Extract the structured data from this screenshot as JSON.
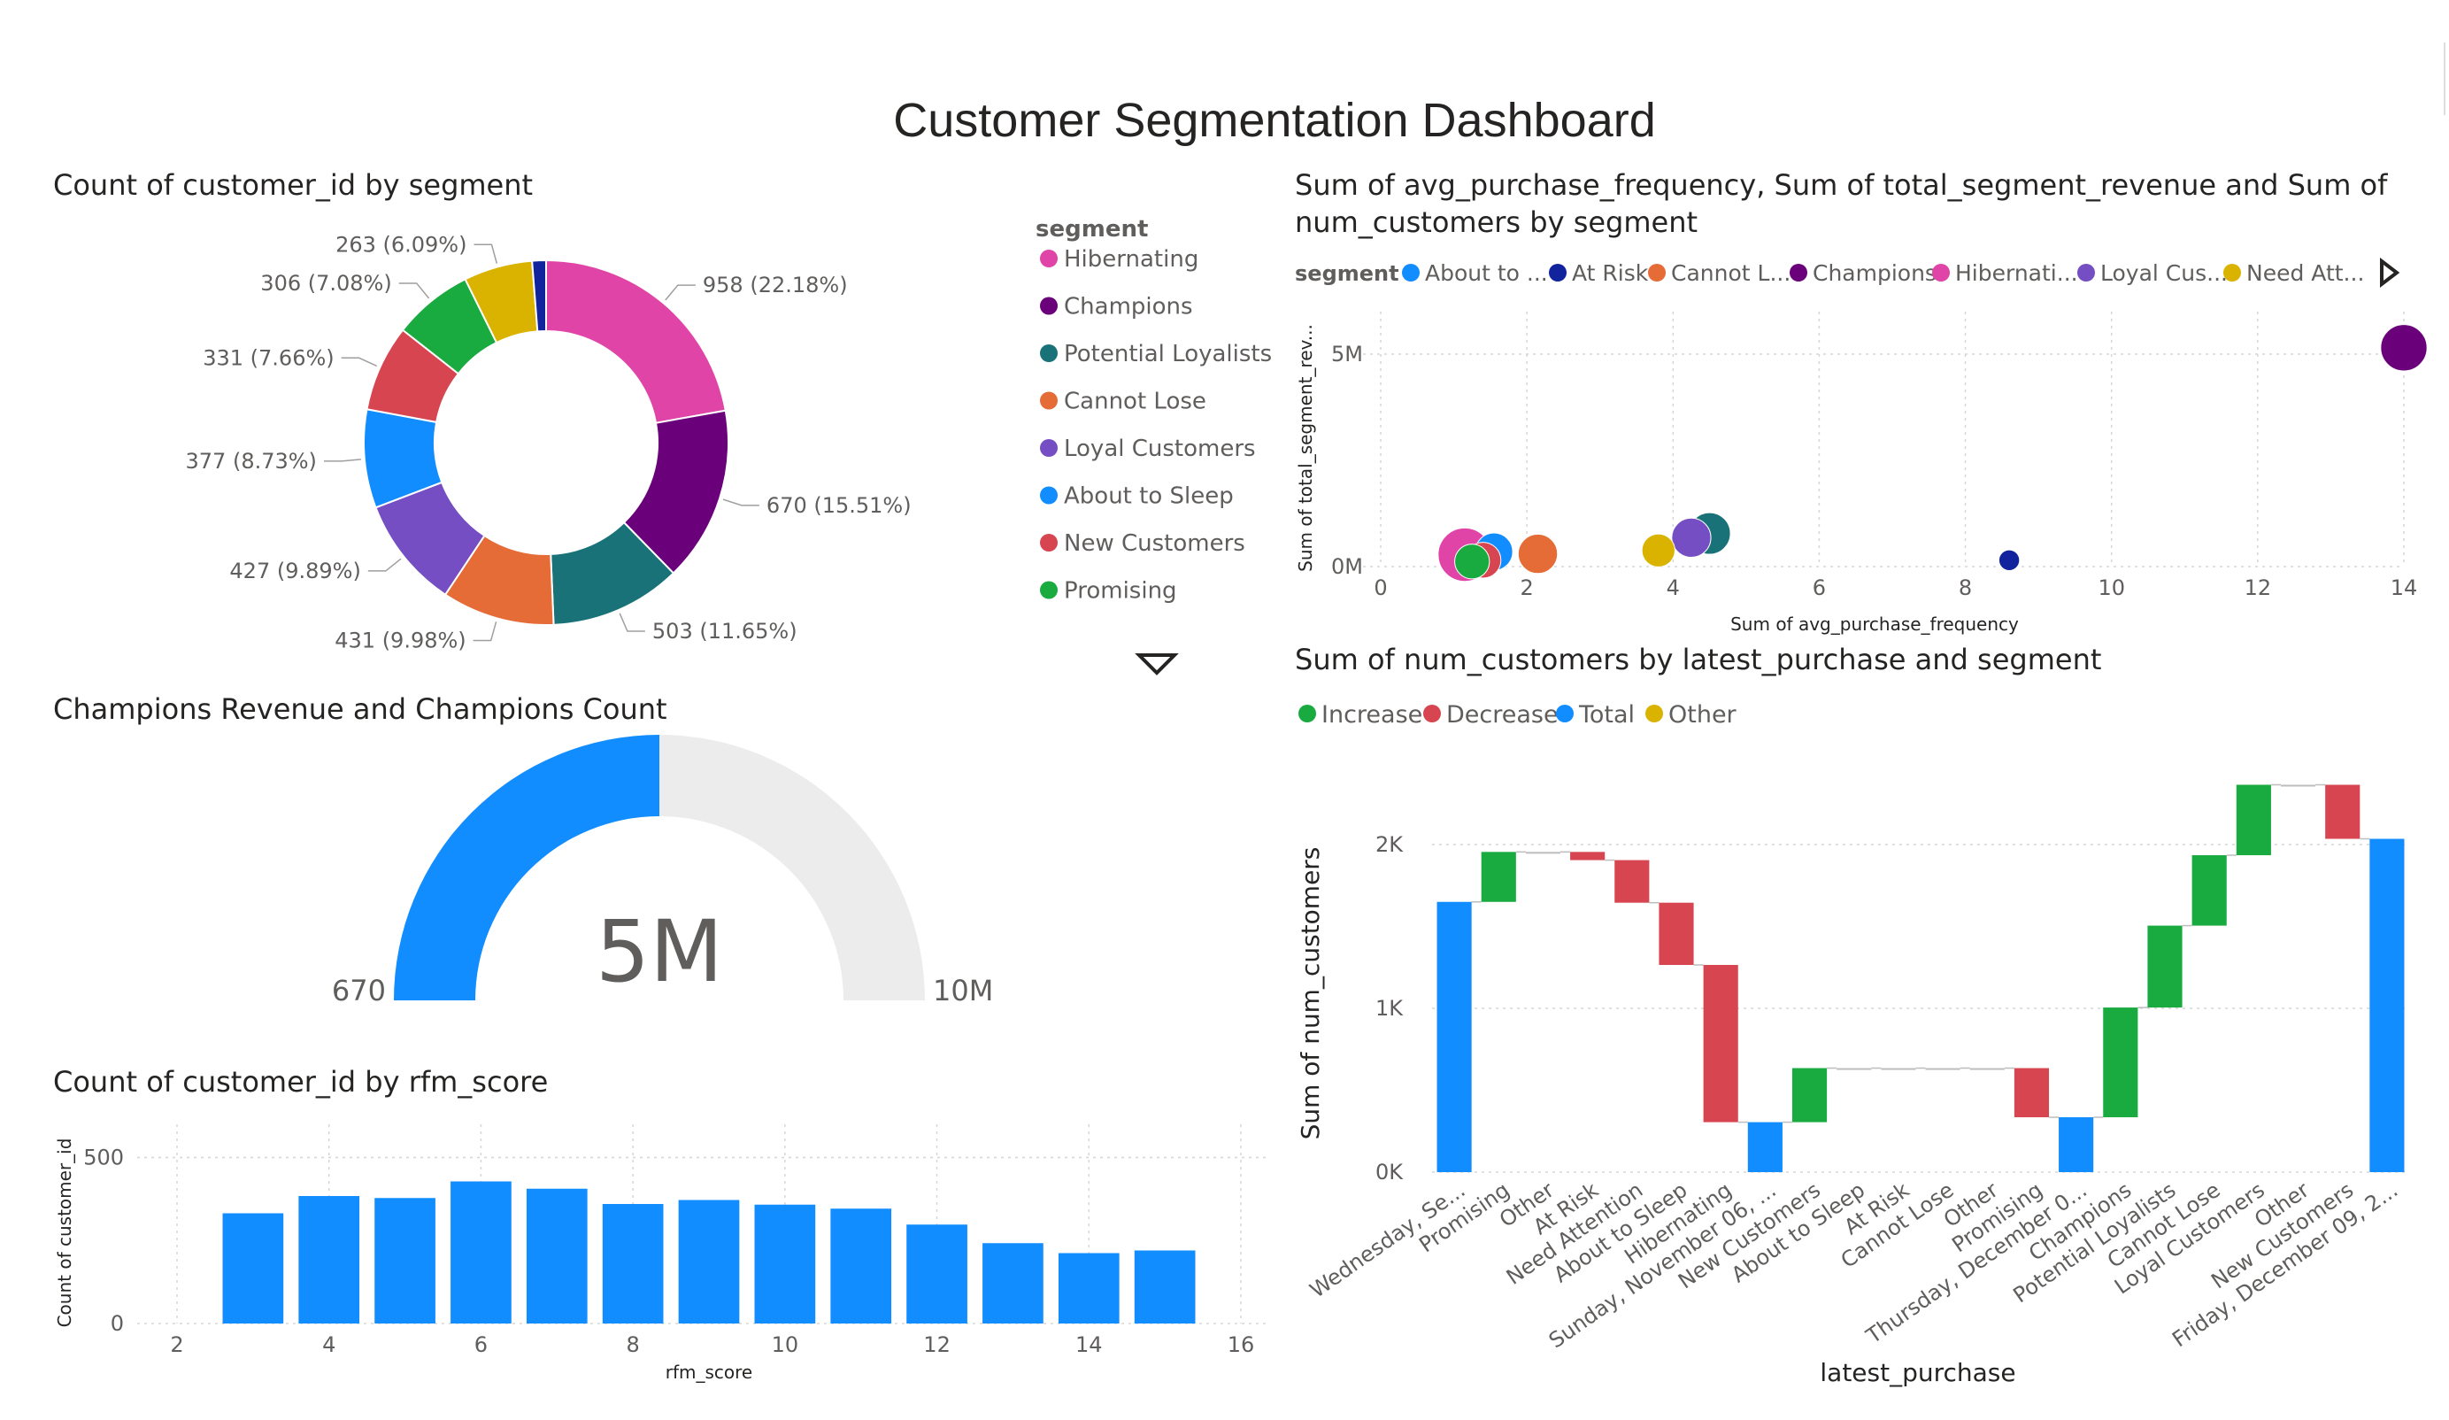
{
  "dashboard": {
    "title": "Customer Segmentation Dashboard"
  },
  "colors": {
    "About to Sleep": "#118DFF",
    "At Risk": "#12239E",
    "Cannot Lose": "#E66C37",
    "Champions": "#6B007B",
    "Hibernating": "#E044A7",
    "Loyal Customers": "#744EC2",
    "Need Attention": "#D9B300",
    "New Customers": "#D64550",
    "Potential Loyalists": "#197278",
    "Promising": "#1AAB40",
    "increase": "#1AAB40",
    "decrease": "#D64550",
    "total": "#118DFF",
    "other": "#D9B300"
  },
  "donut": {
    "title": "Count of customer_id by segment",
    "legend_title": "segment",
    "legend": [
      "Hibernating",
      "Champions",
      "Potential Loyalists",
      "Cannot Lose",
      "Loyal Customers",
      "About to Sleep",
      "New Customers",
      "Promising"
    ],
    "legend_scroll_icon": "chevron-down-icon"
  },
  "gauge": {
    "title": "Champions Revenue and Champions Count",
    "value_label": "5M",
    "min_label": "670",
    "max_label": "10M",
    "fill_fraction": 0.5
  },
  "bar": {
    "title": "Count of customer_id by rfm_score"
  },
  "scatter": {
    "title_line1": "Sum of avg_purchase_frequency, Sum of total_segment_revenue and Sum of",
    "title_line2": "num_customers by segment",
    "legend_title": "segment",
    "legend": [
      {
        "label": "About to ...",
        "key": "About to Sleep"
      },
      {
        "label": "At Risk",
        "key": "At Risk"
      },
      {
        "label": "Cannot L...",
        "key": "Cannot Lose"
      },
      {
        "label": "Champions",
        "key": "Champions"
      },
      {
        "label": "Hibernati...",
        "key": "Hibernating"
      },
      {
        "label": "Loyal Cus...",
        "key": "Loyal Customers"
      },
      {
        "label": "Need Att...",
        "key": "Need Attention"
      }
    ],
    "legend_next_icon": "chevron-right-icon"
  },
  "waterfall": {
    "title": "Sum of num_customers by latest_purchase and segment",
    "legend": [
      {
        "label": "Increase",
        "key": "increase"
      },
      {
        "label": "Decrease",
        "key": "decrease"
      },
      {
        "label": "Total",
        "key": "total"
      },
      {
        "label": "Other",
        "key": "other"
      }
    ]
  },
  "chart_data": [
    {
      "type": "pie",
      "title": "Count of customer_id by segment",
      "donut": true,
      "slices": [
        {
          "label": "Hibernating",
          "value": 958,
          "text": "958 (22.18%)"
        },
        {
          "label": "Champions",
          "value": 670,
          "text": "670 (15.51%)"
        },
        {
          "label": "Potential Loyalists",
          "value": 503,
          "text": "503 (11.65%)"
        },
        {
          "label": "Cannot Lose",
          "value": 431,
          "text": "431 (9.98%)"
        },
        {
          "label": "Loyal Customers",
          "value": 427,
          "text": "427 (9.89%)"
        },
        {
          "label": "About to Sleep",
          "value": 377,
          "text": "377 (8.73%)"
        },
        {
          "label": "New Customers",
          "value": 331,
          "text": "331 (7.66%)"
        },
        {
          "label": "Promising",
          "value": 306,
          "text": "306 (7.08%)"
        },
        {
          "label": "Need Attention",
          "value": 263,
          "text": "263 (6.09%)"
        },
        {
          "label": "At Risk",
          "value": 53,
          "text": ""
        }
      ],
      "legend_placement": "right"
    },
    {
      "type": "bar",
      "title": "Count of customer_id by rfm_score",
      "xlabel": "rfm_score",
      "ylabel": "Count of customer_id",
      "x": [
        3,
        4,
        5,
        6,
        7,
        8,
        9,
        10,
        11,
        12,
        13,
        14,
        15
      ],
      "values": [
        332,
        384,
        378,
        428,
        406,
        360,
        372,
        358,
        346,
        298,
        242,
        212,
        220
      ],
      "xlim": [
        2,
        16
      ],
      "ylim": [
        0,
        600
      ],
      "xticks": [
        2,
        4,
        6,
        8,
        10,
        12,
        14,
        16
      ],
      "yticks": [
        {
          "v": 0,
          "t": "0"
        },
        {
          "v": 500,
          "t": "500"
        }
      ],
      "grid": true
    },
    {
      "type": "scatter",
      "title": "Sum of avg_purchase_frequency, Sum of total_segment_revenue and Sum of num_customers by segment",
      "xlabel": "Sum of avg_purchase_frequency",
      "ylabel": "Sum of total_segment_rev...",
      "xlim": [
        0,
        14
      ],
      "ylim": [
        0,
        6000000
      ],
      "xticks": [
        0,
        2,
        4,
        6,
        8,
        10,
        12,
        14
      ],
      "yticks": [
        {
          "v": 0,
          "t": "0M"
        },
        {
          "v": 5000000,
          "t": "5M"
        }
      ],
      "points": [
        {
          "segment": "Hibernating",
          "x": 1.15,
          "y": 280000,
          "size": 958
        },
        {
          "segment": "Promising",
          "x": 1.25,
          "y": 120000,
          "size": 306
        },
        {
          "segment": "New Customers",
          "x": 1.4,
          "y": 150000,
          "size": 331
        },
        {
          "segment": "About to Sleep",
          "x": 1.55,
          "y": 350000,
          "size": 377
        },
        {
          "segment": "Cannot Lose",
          "x": 2.15,
          "y": 300000,
          "size": 431
        },
        {
          "segment": "Need Attention",
          "x": 3.8,
          "y": 380000,
          "size": 263
        },
        {
          "segment": "Loyal Customers",
          "x": 4.25,
          "y": 680000,
          "size": 427
        },
        {
          "segment": "Potential Loyalists",
          "x": 4.5,
          "y": 780000,
          "size": 503
        },
        {
          "segment": "At Risk",
          "x": 8.6,
          "y": 150000,
          "size": 53
        },
        {
          "segment": "Champions",
          "x": 14.0,
          "y": 5150000,
          "size": 670
        }
      ],
      "grid": true,
      "legend_placement": "top"
    },
    {
      "type": "bar",
      "subtype": "waterfall",
      "title": "Sum of num_customers by latest_purchase and segment",
      "xlabel": "latest_purchase",
      "ylabel": "Sum of num_customers",
      "ylim": [
        0,
        2400
      ],
      "yticks": [
        {
          "v": 0,
          "t": "0K"
        },
        {
          "v": 1000,
          "t": "1K"
        },
        {
          "v": 2000,
          "t": "2K"
        }
      ],
      "categories": [
        "Wednesday, Se...",
        "Promising",
        "Other",
        "At Risk",
        "Need Attention",
        "About to Sleep",
        "Hibernating",
        "Sunday, November 06, ...",
        "New Customers",
        "About to Sleep",
        "At Risk",
        "Cannot Lose",
        "Other",
        "Promising",
        "Thursday, December 0...",
        "Champions",
        "Potential Loyalists",
        "Cannot Lose",
        "Loyal Customers",
        "Other",
        "New Customers",
        "Friday, December 09, 2..."
      ],
      "bars": [
        {
          "kind": "total",
          "start": 0,
          "end": 1650
        },
        {
          "kind": "increase",
          "start": 1650,
          "end": 1955
        },
        {
          "kind": "other",
          "start": 1955,
          "end": 1955
        },
        {
          "kind": "decrease",
          "start": 1955,
          "end": 1905
        },
        {
          "kind": "decrease",
          "start": 1905,
          "end": 1645
        },
        {
          "kind": "decrease",
          "start": 1645,
          "end": 1265
        },
        {
          "kind": "decrease",
          "start": 1265,
          "end": 305
        },
        {
          "kind": "total",
          "start": 0,
          "end": 305
        },
        {
          "kind": "increase",
          "start": 305,
          "end": 635
        },
        {
          "kind": "other",
          "start": 635,
          "end": 635
        },
        {
          "kind": "other",
          "start": 635,
          "end": 635
        },
        {
          "kind": "other",
          "start": 635,
          "end": 635
        },
        {
          "kind": "other",
          "start": 635,
          "end": 635
        },
        {
          "kind": "decrease",
          "start": 635,
          "end": 335
        },
        {
          "kind": "total",
          "start": 0,
          "end": 335
        },
        {
          "kind": "increase",
          "start": 335,
          "end": 1005
        },
        {
          "kind": "increase",
          "start": 1005,
          "end": 1505
        },
        {
          "kind": "increase",
          "start": 1505,
          "end": 1935
        },
        {
          "kind": "increase",
          "start": 1935,
          "end": 2365
        },
        {
          "kind": "other",
          "start": 2365,
          "end": 2365
        },
        {
          "kind": "decrease",
          "start": 2365,
          "end": 2035
        },
        {
          "kind": "total",
          "start": 0,
          "end": 2035
        }
      ],
      "grid": true,
      "legend_placement": "top-left"
    }
  ]
}
